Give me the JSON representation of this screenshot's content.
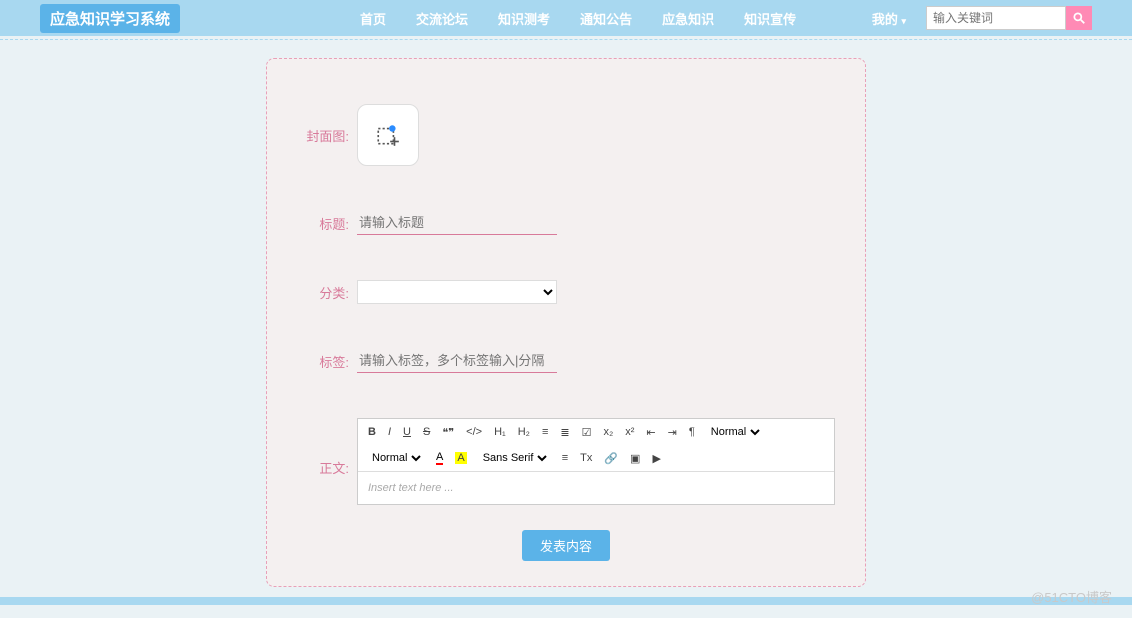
{
  "header": {
    "logo": "应急知识学习系统",
    "nav": [
      "首页",
      "交流论坛",
      "知识测考",
      "通知公告",
      "应急知识",
      "知识宣传"
    ],
    "mine": "我的",
    "search_placeholder": "输入关键词"
  },
  "form": {
    "cover_label": "封面图:",
    "title_label": "标题:",
    "title_placeholder": "请输入标题",
    "category_label": "分类:",
    "tags_label": "标签:",
    "tags_placeholder": "请输入标签，多个标签输入|分隔",
    "body_label": "正文:",
    "editor_placeholder": "Insert text here ...",
    "submit": "发表内容"
  },
  "toolbar": {
    "bold": "B",
    "italic": "I",
    "underline": "U",
    "strike": "S",
    "quote": "❝❞",
    "code": "</>",
    "h1": "H₁",
    "h2": "H₂",
    "ol": "≡",
    "ul": "≣",
    "check": "☑",
    "sub": "x₂",
    "sup": "x²",
    "indent_l": "⇤",
    "indent_r": "⇥",
    "rtl": "¶",
    "header_pick": "Normal",
    "size_pick": "Normal",
    "color": "A",
    "bg": "A",
    "font_pick": "Sans Serif",
    "align": "≡",
    "clear": "Tx",
    "link": "🔗",
    "image": "▣",
    "video": "▶"
  },
  "watermark": "@51CTO博客"
}
